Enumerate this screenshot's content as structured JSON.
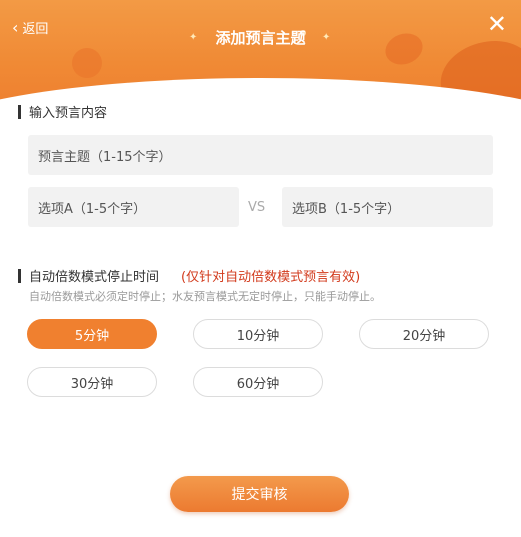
{
  "header": {
    "back_label": "返回",
    "title": "添加预言主题",
    "close_glyph": "✕"
  },
  "content_section": {
    "title": "输入预言内容",
    "topic_placeholder": "预言主题（1-15个字）",
    "option_a_placeholder": "选项A（1-5个字）",
    "vs_label": "VS",
    "option_b_placeholder": "选项B（1-5个字）"
  },
  "stop_section": {
    "title": "自动倍数模式停止时间",
    "note": "(仅针对自动倍数模式预言有效)",
    "subtitle": "自动倍数模式必须定时停止；水友预言模式无定时停止，只能手动停止。",
    "options": [
      "5分钟",
      "10分钟",
      "20分钟",
      "30分钟",
      "60分钟"
    ],
    "selected": "5分钟"
  },
  "submit_label": "提交审核",
  "colors": {
    "accent": "#f0802f",
    "note": "#d23a1c"
  },
  "icons": {
    "back": "chevron-left-icon",
    "close": "close-icon"
  }
}
